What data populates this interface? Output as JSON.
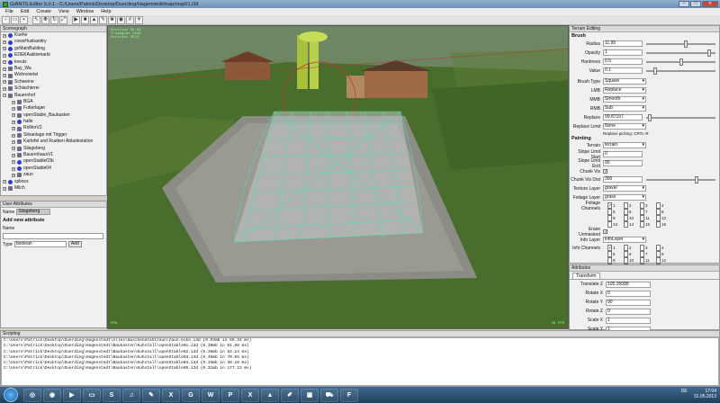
{
  "window": {
    "title": "GIANTS Editor 5.0.1 - C:/Users/Patrick/Desktop/Duerding/Hagenstedt/map/map01.i3d"
  },
  "menu": [
    "File",
    "Edit",
    "Create",
    "View",
    "Window",
    "Help"
  ],
  "scenegraph": {
    "header": "Scenegraph",
    "items": [
      {
        "label": "Kuehe",
        "level": 0,
        "kind": "group",
        "tog": "+"
      },
      {
        "label": "cowsHusbandry",
        "level": 0,
        "kind": "group",
        "tog": "+"
      },
      {
        "label": "gcMainBuilding",
        "level": 0,
        "kind": "group",
        "tog": "+"
      },
      {
        "label": "EDEKAaktivmarkt",
        "level": 0,
        "kind": "group",
        "tog": "+"
      },
      {
        "label": "kreutz",
        "level": 0,
        "kind": "group",
        "tog": "+"
      },
      {
        "label": "Bay_Wa",
        "level": 0,
        "kind": "tg",
        "tog": "+"
      },
      {
        "label": "Wohnviertel",
        "level": 0,
        "kind": "tg",
        "tog": "+"
      },
      {
        "label": "Schweine",
        "level": 0,
        "kind": "tg",
        "tog": "+"
      },
      {
        "label": "Schlachterei",
        "level": 0,
        "kind": "tg",
        "tog": "+"
      },
      {
        "label": "Bauernhof",
        "level": 0,
        "kind": "tg",
        "tog": "−"
      },
      {
        "label": "BGA",
        "level": 1,
        "kind": "tg",
        "tog": "+"
      },
      {
        "label": "Futterlager",
        "level": 1,
        "kind": "tg",
        "tog": "+"
      },
      {
        "label": "openStable_Baukasten",
        "level": 1,
        "kind": "tg",
        "tog": "+"
      },
      {
        "label": "halle",
        "level": 1,
        "kind": "group",
        "tog": "+"
      },
      {
        "label": "RolltorV2",
        "level": 1,
        "kind": "tg",
        "tog": "+"
      },
      {
        "label": "Siloanlage mit Trigger",
        "level": 1,
        "kind": "tg",
        "tog": "+"
      },
      {
        "label": "Kartofel und Rueben Abladestation",
        "level": 1,
        "kind": "tg",
        "tog": "+"
      },
      {
        "label": "Silageberg",
        "level": 1,
        "kind": "tg",
        "tog": "+"
      },
      {
        "label": "BauernhausV1",
        "level": 1,
        "kind": "tg",
        "tog": "+"
      },
      {
        "label": "openStable03b",
        "level": 1,
        "kind": "group",
        "tog": "+"
      },
      {
        "label": "openStable04",
        "level": 1,
        "kind": "group",
        "tog": "+"
      },
      {
        "label": "zaun",
        "level": 1,
        "kind": "tg",
        "tog": "+"
      },
      {
        "label": "splines",
        "level": 0,
        "kind": "group",
        "tog": "+"
      },
      {
        "label": "Milch",
        "level": 0,
        "kind": "tg",
        "tog": "+"
      }
    ]
  },
  "user_attributes": {
    "header": "User Attributes",
    "name_label": "Name",
    "name_value": "Silageberg",
    "add_title": "Add new attribute",
    "new_name_label": "Name",
    "type_label": "Type",
    "type_value": "boolean",
    "add_button": "Add"
  },
  "viewport": {
    "info": [
      "Position 68.58",
      "Triangles 5948",
      "Vertices 3544"
    ],
    "fps_label": "45 FPS",
    "persp": "PPA"
  },
  "terrain_editing": {
    "header": "Terrain Editing",
    "brush_title": "Brush",
    "radius_label": "Radius",
    "radius": "11.95",
    "opacity_label": "Opacity",
    "opacity": "1",
    "hardness_label": "Hardness",
    "hardness": "0.5",
    "value_label": "Value",
    "value": "0.1",
    "brush_type_label": "Brush Type",
    "brush_type": "Square",
    "lmb_label": "LMB",
    "lmb": "Replace",
    "mmb_label": "MMB",
    "mmb": "Smooth",
    "rmb_label": "RMB",
    "rmb": "Sub",
    "replace_label": "Replace",
    "replace": "99.87157",
    "replace_limit_label": "Replace Limit",
    "replace_limit": "None",
    "replace_picking": "Replace picking: CRTL-R",
    "painting_title": "Painting",
    "terrain_label": "Terrain",
    "terrain": "terrain",
    "slope_start_label": "Slope Limit Start",
    "slope_start": "0",
    "slope_end_label": "Slope Limit End",
    "slope_end": "90",
    "chunk_vis_label": "Chunk Vis",
    "chunk_vis_dist_label": "Chunk Vis Dist",
    "chunk_vis_dist": "300",
    "texture_layer_label": "Texture Layer",
    "texture_layer": "gravel",
    "foliage_layer_label": "Foliage Layer",
    "foliage_layer": "grass",
    "foliage_channels_label": "Foliage Channels",
    "channels": [
      "1",
      "2",
      "3",
      "4",
      "5",
      "6",
      "7",
      "8",
      "9",
      "10",
      "11",
      "12",
      "13",
      "14",
      "15",
      "16"
    ],
    "erase_unmasked_label": "Erase Unmasked",
    "info_layer_label": "Info Layer",
    "info_layer": "infoLayer",
    "info_channels_label": "Info Channels"
  },
  "attributes": {
    "header": "Attributes",
    "tab": "Transform",
    "rows": [
      {
        "label": "Translate Z",
        "value": "105.35088"
      },
      {
        "label": "Rotate X",
        "value": "0"
      },
      {
        "label": "Rotate Y",
        "value": "90"
      },
      {
        "label": "Rotate Z",
        "value": "0"
      },
      {
        "label": "Scale X",
        "value": "1"
      },
      {
        "label": "Scale Y",
        "value": "1"
      }
    ]
  },
  "scripting": {
    "header": "Scripting",
    "lines": [
      "C:\\Users\\Patrick\\Desktop\\Duerding\\Hagenstedt\\Alles\\maschendrahtzaun\\zaun-ecke.i3d (0.03mb in 55.34 ms)",
      "C:\\Users\\Patrick\\Desktop\\Duerding\\Hagenstedt\\Baukasten\\Kuhstall\\openStable01.i3d (0.39mb in 51.88 ms)",
      "C:\\Users\\Patrick\\Desktop\\Duerding\\Hagenstedt\\Baukasten\\Kuhstall\\openStable02.i3d (0.39mb in 63.24 ms)",
      "C:\\Users\\Patrick\\Desktop\\Duerding\\Hagenstedt\\Baukasten\\Kuhstall\\openStable03.i3d (0.49mb in 70.65 ms)",
      "C:\\Users\\Patrick\\Desktop\\Duerding\\Hagenstedt\\Baukasten\\Kuhstall\\openStable04.i3d (0.34mb in 30.19 ms)",
      "C:\\Users\\Patrick\\Desktop\\Duerding\\Hagenstedt\\Baukasten\\Kuhstall\\openStable05.i3d (0.31mb in 177.23 ms)"
    ]
  },
  "taskbar": {
    "apps": [
      "chrome",
      "firefox",
      "wmp",
      "folder",
      "skype",
      "media",
      "notes",
      "excel",
      "giants",
      "word",
      "powerpoint",
      "excel2",
      "vlc",
      "editor",
      "photo",
      "tractor",
      "fs"
    ],
    "lang": "DE",
    "time": "17:04",
    "date": "31.05.2013"
  }
}
